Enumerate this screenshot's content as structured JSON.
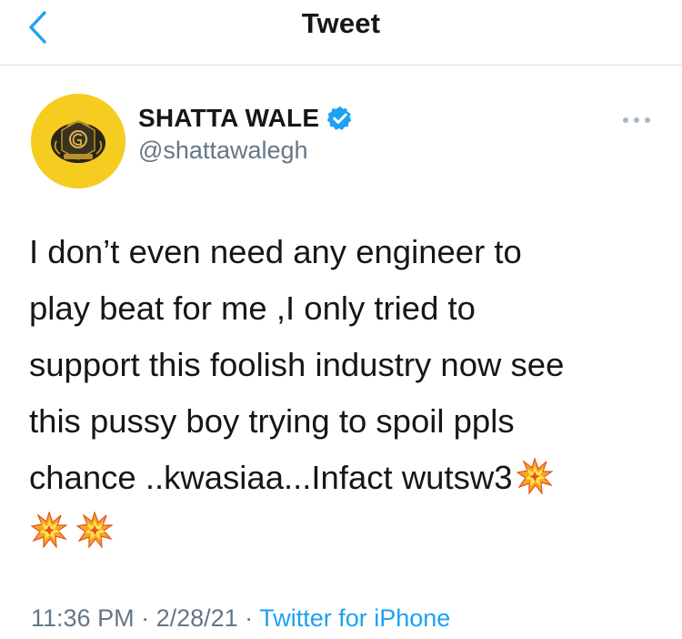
{
  "header": {
    "title": "Tweet"
  },
  "tweet": {
    "author_name": "SHATTA WALE",
    "author_handle": "@shattawalegh",
    "verified": true,
    "text": "I don’t even need any engineer to\nplay beat for me ,I only tried to\nsupport this foolish industry now see\nthis pussy boy trying to spoil ppls\nchance ..kwasiaa...Infact wutsw3",
    "emoji": [
      "collision",
      "collision",
      "collision"
    ],
    "time": "11:36 PM",
    "separator": " · ",
    "date": "2/28/21",
    "source": "Twitter for iPhone"
  },
  "colors": {
    "link_blue": "#1da1f2",
    "secondary_gray": "#657786",
    "avatar_yellow": "#f5cc1f"
  },
  "icons": [
    "back-chevron-icon",
    "verified-badge-icon",
    "more-options-icon",
    "collision-emoji-icon"
  ]
}
